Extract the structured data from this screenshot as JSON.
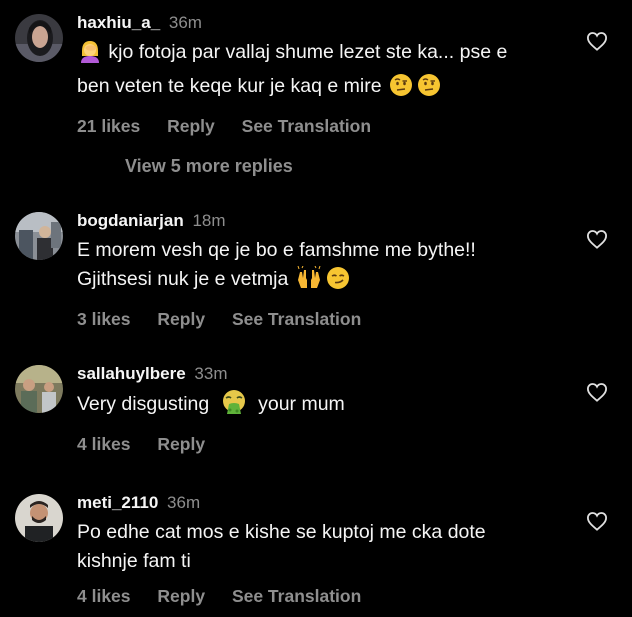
{
  "colors": {
    "background": "#000000",
    "primary_text": "#f5f5f5",
    "secondary_text": "#8e8e8e"
  },
  "comments": [
    {
      "username": "haxhiu_a_",
      "time": "36m",
      "text_part1": "kjo fotoja par vallaj shume lezet ste ka... pse e",
      "text_part2": "ben veten te keqe kur je kaq e mire",
      "emojis": [
        "woman-facepalming-emoji",
        "face-with-raised-eyebrow-emoji",
        "face-with-raised-eyebrow-emoji"
      ],
      "likes": "21 likes",
      "reply": "Reply",
      "translation": "See Translation"
    },
    {
      "username": "bogdaniarjan",
      "time": "18m",
      "text_part1": "E morem vesh qe je bo e famshme me bythe!!",
      "text_part2": "Gjithsesi nuk je e vetmja",
      "emojis": [
        "raising-hands-emoji",
        "smirking-face-emoji"
      ],
      "likes": "3 likes",
      "reply": "Reply",
      "translation": "See Translation"
    },
    {
      "username": "sallahuylbere",
      "time": "33m",
      "text_part1": "Very disgusting",
      "text_part2": "your mum",
      "emojis": [
        "vomiting-face-emoji"
      ],
      "likes": "4 likes",
      "reply": "Reply"
    },
    {
      "username": "meti_2110",
      "time": "36m",
      "text_part1": "Po edhe cat mos e kishe se kuptoj me cka dote",
      "text_part2": "kishnje fam ti",
      "likes": "4 likes",
      "reply": "Reply",
      "translation": "See Translation"
    }
  ],
  "view_more_replies": "View 5 more replies"
}
